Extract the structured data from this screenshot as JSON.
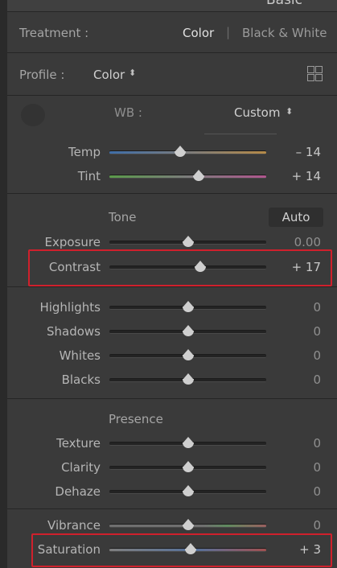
{
  "header": {
    "title": "Basic"
  },
  "treatment": {
    "label": "Treatment :",
    "color": "Color",
    "divider": "|",
    "bw": "Black & White"
  },
  "profile": {
    "label": "Profile :",
    "value": "Color",
    "arrows": "⬍",
    "browser_icon": "grid-icon"
  },
  "wb": {
    "label": "WB :",
    "value": "Custom",
    "arrows": "⬍",
    "dropper_icon": "eyedropper-icon",
    "sliders": [
      {
        "label": "Temp",
        "value": "– 14",
        "level": 0.45
      },
      {
        "label": "Tint",
        "value": "+ 14",
        "level": 0.57
      }
    ]
  },
  "tone": {
    "label": "Tone",
    "auto": "Auto",
    "sliders": [
      {
        "label": "Exposure",
        "value": "0.00",
        "level": 0.5
      },
      {
        "label": "Contrast",
        "value": "+ 17",
        "level": 0.58
      }
    ],
    "sliders2": [
      {
        "label": "Highlights",
        "value": "0",
        "level": 0.5
      },
      {
        "label": "Shadows",
        "value": "0",
        "level": 0.5
      },
      {
        "label": "Whites",
        "value": "0",
        "level": 0.5
      },
      {
        "label": "Blacks",
        "value": "0",
        "level": 0.5
      }
    ]
  },
  "presence": {
    "label": "Presence",
    "sliders": [
      {
        "label": "Texture",
        "value": "0",
        "level": 0.5
      },
      {
        "label": "Clarity",
        "value": "0",
        "level": 0.5
      },
      {
        "label": "Dehaze",
        "value": "0",
        "level": 0.5
      },
      {
        "label": "Vibrance",
        "value": "0",
        "level": 0.5
      },
      {
        "label": "Saturation",
        "value": "+ 3",
        "level": 0.52
      }
    ]
  },
  "colors": {
    "highlight_box": "#d0202c",
    "panel_bg": "#3a3a3a"
  }
}
